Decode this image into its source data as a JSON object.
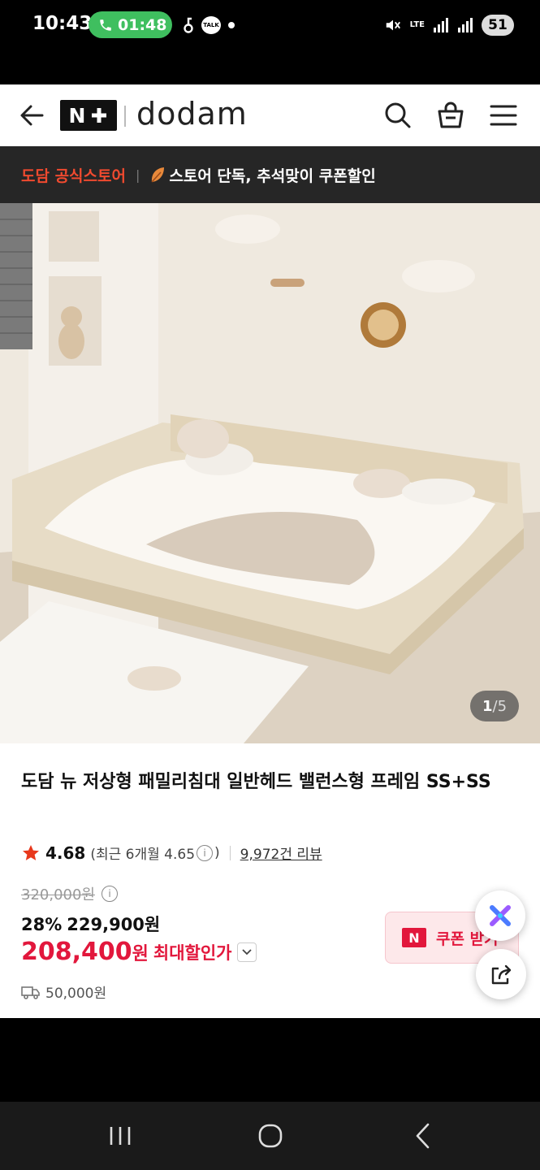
{
  "status_bar": {
    "time": "10:43",
    "call_timer": "01:48",
    "talk_label": "TALK",
    "network": "LTE",
    "battery": "51"
  },
  "header": {
    "logo_text": "N",
    "brand": "dodam"
  },
  "banner": {
    "store_name": "도담 공식스토어",
    "promo": "스토어 단독, 추석맞이 쿠폰할인"
  },
  "gallery": {
    "current": "1",
    "total": "/5"
  },
  "product": {
    "title": "도담 뉴 저상형 패밀리침대 일반헤드 밸런스형 프레임 SS+SS",
    "rating": "4.68",
    "recent_prefix": "(최근 6개월 4.65",
    "recent_suffix": ")",
    "reviews": "9,972건 리뷰",
    "original_price": "320,000원",
    "discount_rate": "28%",
    "sale_price": "229,900원",
    "max_price": "208,400",
    "max_won": "원",
    "max_label": "최대할인가",
    "shipping_fee": "50,000원",
    "coupon_button": "쿠폰 받기"
  },
  "colors": {
    "accent_red": "#e2173c",
    "store_orange": "#f04a2f",
    "banner_bg": "#262626"
  }
}
